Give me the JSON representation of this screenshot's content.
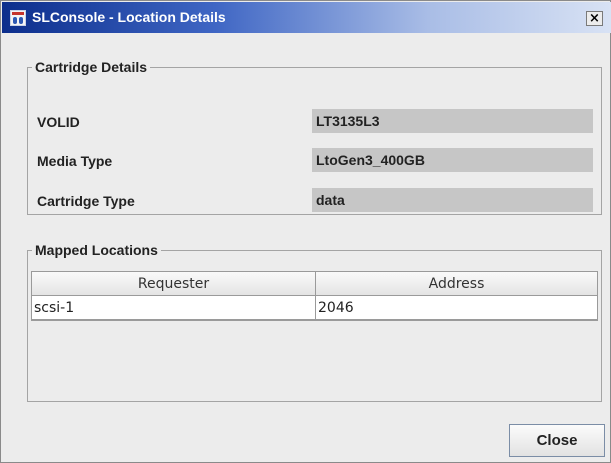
{
  "window": {
    "title": "SLConsole - Location Details",
    "close_symbol": "×",
    "app_icon": "slconsole-app-icon"
  },
  "cartridge": {
    "legend": "Cartridge Details",
    "fields": [
      {
        "label": "VOLID",
        "value": "LT3135L3"
      },
      {
        "label": "Media Type",
        "value": "LtoGen3_400GB"
      },
      {
        "label": "Cartridge Type",
        "value": "data"
      }
    ]
  },
  "mapped": {
    "legend": "Mapped Locations",
    "columns": [
      "Requester",
      "Address"
    ],
    "rows": [
      {
        "requester": "scsi-1",
        "address": "2046"
      }
    ]
  },
  "buttons": {
    "close": "Close"
  }
}
